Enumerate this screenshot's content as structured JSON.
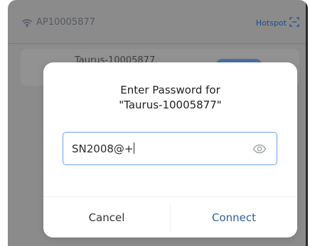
{
  "topbar": {
    "ssid_label": "AP10005877",
    "hotspot_label": "Hotspot"
  },
  "background_card": {
    "title_fragment": "Taurus-10005877"
  },
  "dialog": {
    "title_line_1": "Enter Password for",
    "title_line_2": "\"Taurus-10005877\"",
    "password_value": "SN2008@+",
    "cancel_label": "Cancel",
    "connect_label": "Connect",
    "icons": {
      "wifi": "wifi-icon",
      "hotspot": "hotspot-scan-icon",
      "password_visibility": "eye-icon"
    },
    "colors": {
      "accent": "#2f5f96",
      "field_border": "#6e9ff0",
      "overlay": "#8b8b8b"
    }
  }
}
